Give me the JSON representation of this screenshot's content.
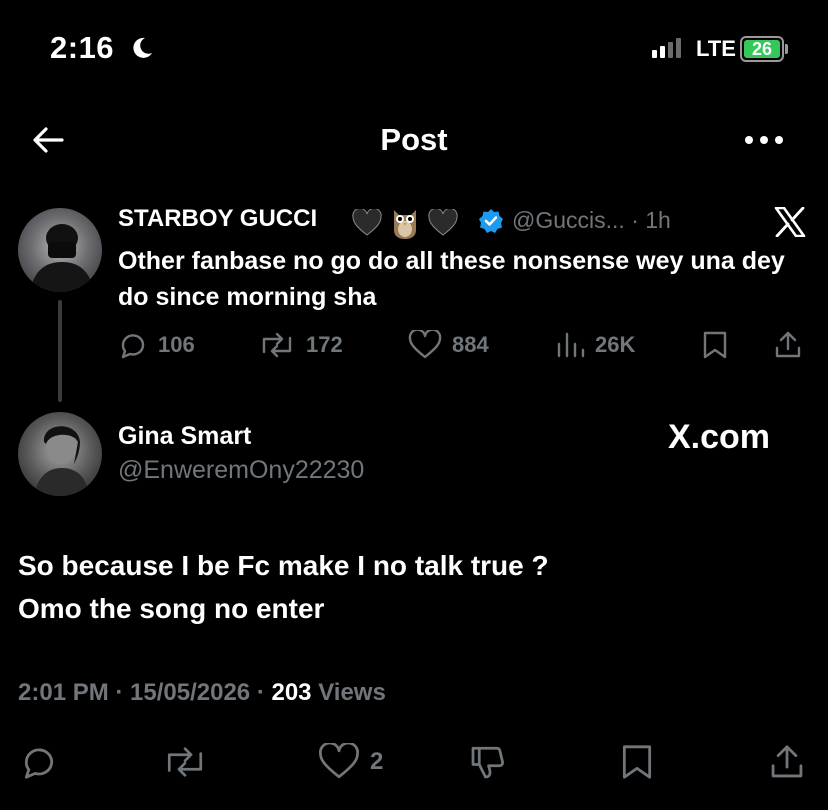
{
  "status_bar": {
    "time": "2:16",
    "network": "LTE",
    "battery": "26"
  },
  "header": {
    "title": "Post"
  },
  "quoted_post": {
    "author_name": "STARBOY GUCCI",
    "emojis": [
      "black-heart",
      "owl",
      "black-heart"
    ],
    "handle": "@Guccis...",
    "time": "· 1h",
    "text": "Other fanbase no go do all these nonsense wey una dey do since morning sha",
    "stats": {
      "replies": "106",
      "reposts": "172",
      "likes": "884",
      "views": "26K"
    }
  },
  "reply": {
    "author_name": "Gina Smart",
    "handle": "@EnweremOny22230",
    "site": "X.com",
    "body_line1": "So because I be Fc make I no talk true ?",
    "body_line2": "Omo the song no enter",
    "timestamp": "2:01 PM · 15/05/2026 · ",
    "views_count": "203",
    "views_label": " Views",
    "likes": "2"
  },
  "colors": {
    "muted": "#71767b",
    "accent": "#1d9bf0",
    "battery": "#34c759"
  }
}
